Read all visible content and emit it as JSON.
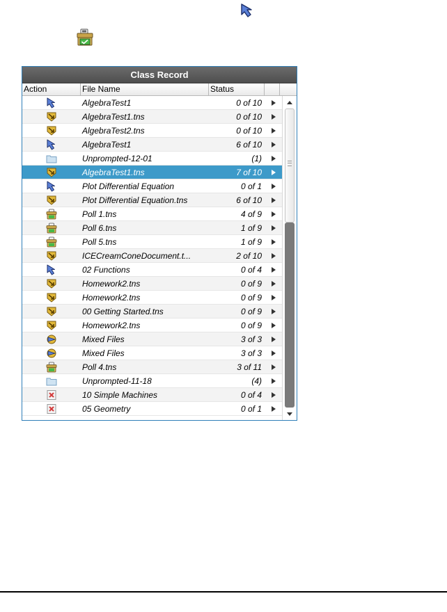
{
  "top_icons": {
    "send_icon": "send-to-class-icon",
    "poll_icon": "poll-icon"
  },
  "panel": {
    "title": "Class Record",
    "columns": {
      "action": "Action",
      "file_name": "File Name",
      "status": "Status"
    },
    "rows": [
      {
        "icon": "send-icon",
        "name": "AlgebraTest1",
        "status": "0 of 10"
      },
      {
        "icon": "collect-icon",
        "name": "AlgebraTest1.tns",
        "status": "0 of 10"
      },
      {
        "icon": "collect-icon",
        "name": "AlgebraTest2.tns",
        "status": "0 of 10"
      },
      {
        "icon": "send-icon",
        "name": "AlgebraTest1",
        "status": "6 of 10"
      },
      {
        "icon": "folder-icon",
        "name": "Unprompted-12-01",
        "status": "(1)"
      },
      {
        "icon": "collect-icon",
        "name": "AlgebraTest1.tns",
        "status": "7 of 10",
        "selected": true
      },
      {
        "icon": "send-icon",
        "name": "Plot Differential Equation",
        "status": "0 of 1"
      },
      {
        "icon": "collect-icon",
        "name": "Plot Differential Equation.tns",
        "status": "6 of 10"
      },
      {
        "icon": "poll-icon",
        "name": "Poll 1.tns",
        "status": "4 of 9"
      },
      {
        "icon": "poll-icon",
        "name": "Poll 6.tns",
        "status": "1 of 9"
      },
      {
        "icon": "poll-icon",
        "name": "Poll 5.tns",
        "status": "1 of 9"
      },
      {
        "icon": "collect-icon",
        "name": "ICECreamConeDocument.t...",
        "status": "2 of 10"
      },
      {
        "icon": "send-icon",
        "name": "02 Functions",
        "status": "0 of 4"
      },
      {
        "icon": "collect-icon",
        "name": "Homework2.tns",
        "status": "0 of 9"
      },
      {
        "icon": "collect-icon",
        "name": "Homework2.tns",
        "status": "0 of 9"
      },
      {
        "icon": "collect-icon",
        "name": "00 Getting Started.tns",
        "status": "0 of 9"
      },
      {
        "icon": "collect-icon",
        "name": "Homework2.tns",
        "status": "0 of 9"
      },
      {
        "icon": "mixed-icon",
        "name": "Mixed Files",
        "status": "3 of 3"
      },
      {
        "icon": "mixed-icon",
        "name": "Mixed Files",
        "status": "3 of 3"
      },
      {
        "icon": "poll-icon",
        "name": "Poll 4.tns",
        "status": "3 of 11"
      },
      {
        "icon": "folder-icon",
        "name": "Unprompted-11-18",
        "status": "(4)"
      },
      {
        "icon": "delete-icon",
        "name": "10 Simple Machines",
        "status": "0 of 4"
      },
      {
        "icon": "delete-icon",
        "name": "05 Geometry",
        "status": "0 of 1"
      }
    ]
  },
  "colors": {
    "selection": "#3d9ac9",
    "title_bar": "#5a5a5a",
    "panel_border": "#2f7fb8"
  }
}
